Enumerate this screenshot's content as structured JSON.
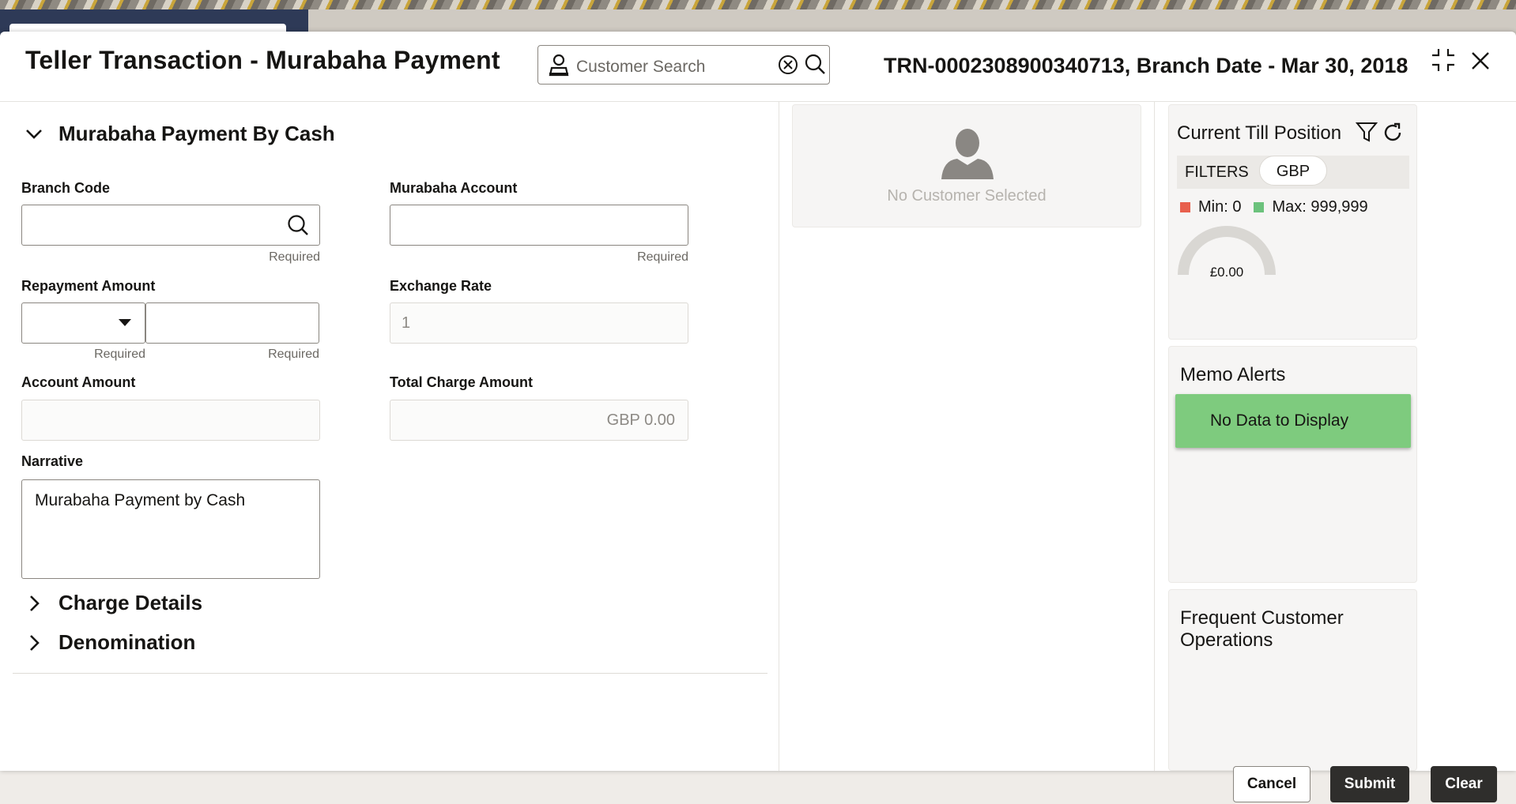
{
  "background": {
    "search_placeholder": ""
  },
  "header": {
    "title": "Teller Transaction - Murabaha Payment",
    "customer_search_placeholder": "Customer Search",
    "transaction_ref": "TRN-0002308900340713, Branch Date - Mar 30, 2018"
  },
  "form": {
    "section_title": "Murabaha Payment By Cash",
    "branch_code": {
      "label": "Branch Code",
      "value": "",
      "hint": "Required"
    },
    "murabaha_account": {
      "label": "Murabaha Account",
      "value": "",
      "hint": "Required"
    },
    "repayment_amount": {
      "label": "Repayment Amount",
      "currency": "",
      "amount": "",
      "currency_hint": "Required",
      "amount_hint": "Required"
    },
    "exchange_rate": {
      "label": "Exchange Rate",
      "value": "1"
    },
    "account_amount": {
      "label": "Account Amount",
      "value": ""
    },
    "total_charge_amount": {
      "label": "Total Charge Amount",
      "value": "GBP 0.00"
    },
    "narrative": {
      "label": "Narrative",
      "value": "Murabaha Payment by Cash"
    },
    "charge_details_title": "Charge Details",
    "denomination_title": "Denomination"
  },
  "customer_card": {
    "message": "No Customer Selected"
  },
  "till_position": {
    "title": "Current Till Position",
    "filters_label": "FILTERS",
    "currency_chip": "GBP",
    "min_label": "Min: 0",
    "max_label": "Max: 999,999",
    "gauge_value": "£0.00",
    "gauge_fraction": 0,
    "colors": {
      "min": "#e8604d",
      "max": "#6cc27c",
      "gauge_track": "#d9d7d3"
    }
  },
  "memo_alerts": {
    "title": "Memo Alerts",
    "message": "No Data to Display"
  },
  "frequent_ops": {
    "title_line1": "Frequent Customer",
    "title_line2": "Operations"
  },
  "footer": {
    "cancel": "Cancel",
    "submit": "Submit",
    "clear": "Clear"
  }
}
